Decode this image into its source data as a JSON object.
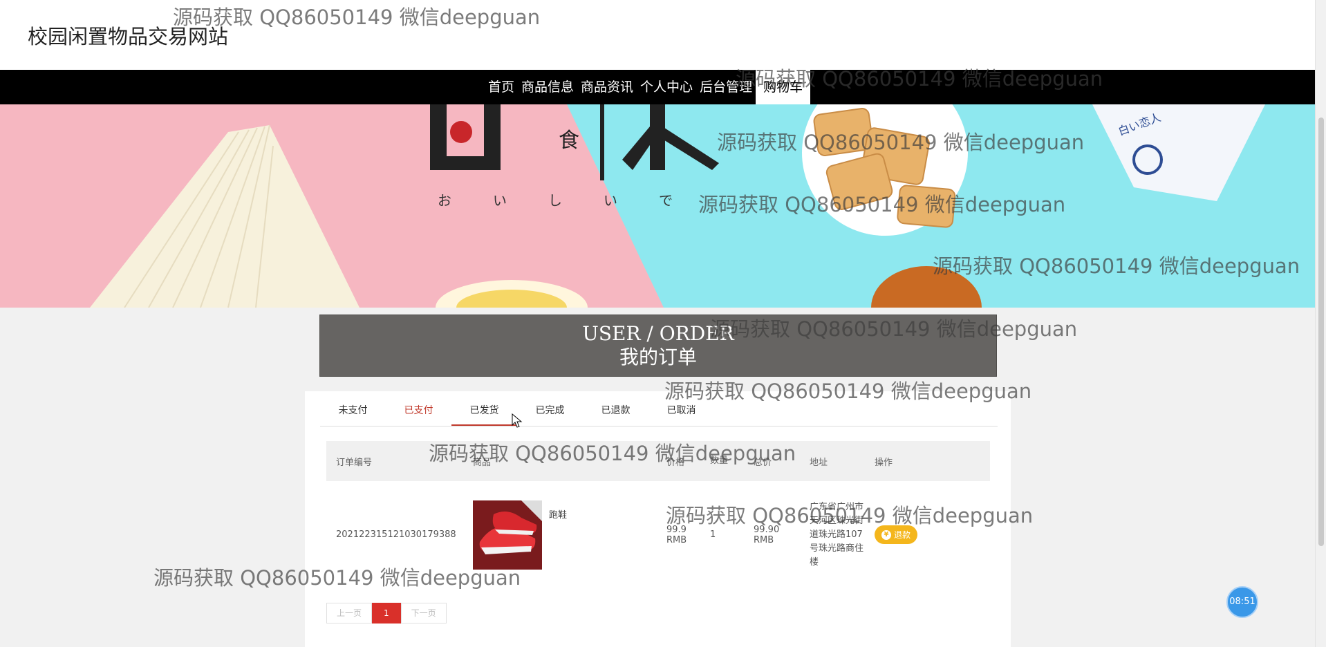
{
  "site": {
    "title": "校园闲置物品交易网站"
  },
  "nav": {
    "items": [
      {
        "label": "首页"
      },
      {
        "label": "商品信息"
      },
      {
        "label": "商品资讯"
      },
      {
        "label": "个人中心"
      },
      {
        "label": "后台管理"
      },
      {
        "label": "购物车"
      }
    ],
    "active": "购物车"
  },
  "banner": {
    "chars": [
      "食",
      "本"
    ],
    "kana": [
      "お",
      "い",
      "し",
      "い",
      "で"
    ],
    "package_text": "白い恋人"
  },
  "order": {
    "title_en": "USER / ORDER",
    "title_cn": "我的订单",
    "tabs": [
      {
        "label": "未支付"
      },
      {
        "label": "已支付"
      },
      {
        "label": "已发货"
      },
      {
        "label": "已完成"
      },
      {
        "label": "已退款"
      },
      {
        "label": "已取消"
      }
    ],
    "active_tab": "已发货",
    "columns": [
      "订单编号",
      "商品",
      "价格",
      "数量",
      "总价",
      "地址",
      "操作"
    ],
    "rows": [
      {
        "order_no": "20212231512103017​9388",
        "product": "跑鞋",
        "price": "99.9 RMB",
        "quantity": "1",
        "total": "99.90 RMB",
        "address": "广东省广州市天河区珠光街道珠光路107号珠光路商住楼",
        "action": "退款"
      }
    ],
    "pagination": {
      "prev": "上一页",
      "current": "1",
      "next": "下一页"
    }
  },
  "clock": {
    "time": "08:51"
  },
  "watermark": {
    "text": "源码获取 QQ86050149 微信deepguan"
  }
}
